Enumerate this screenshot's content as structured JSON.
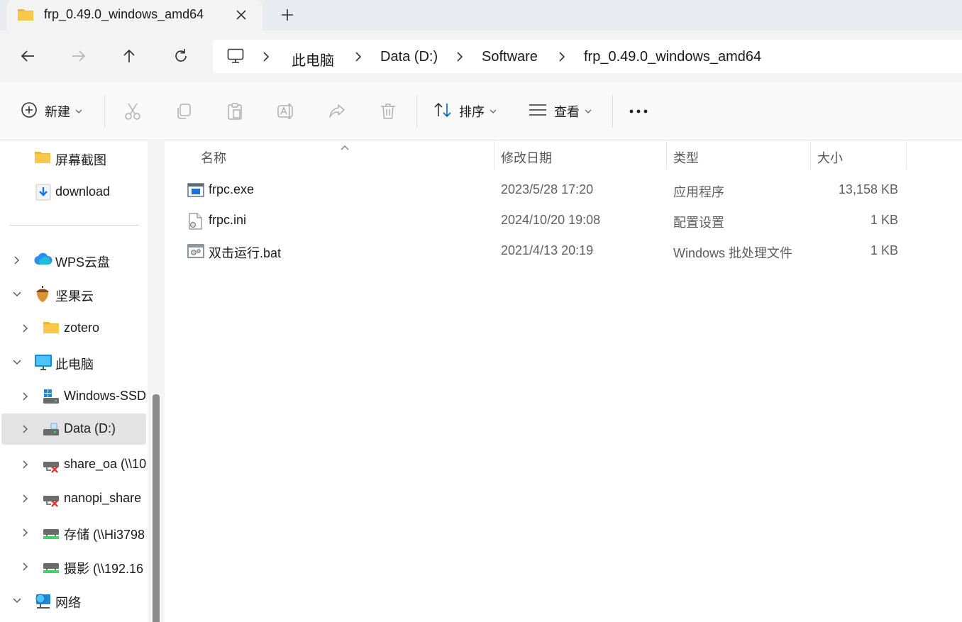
{
  "tab": {
    "title": "frp_0.49.0_windows_amd64",
    "close_icon": "close-icon",
    "new_tab_icon": "plus-icon"
  },
  "nav": {
    "back_icon": "arrow-left-icon",
    "forward_icon": "arrow-right-icon",
    "up_icon": "arrow-up-icon",
    "refresh_icon": "refresh-icon"
  },
  "address": {
    "root_icon": "computer-icon",
    "crumbs": [
      "此电脑",
      "Data (D:)",
      "Software",
      "frp_0.49.0_windows_amd64"
    ]
  },
  "toolbar": {
    "new_label": "新建",
    "sort_label": "排序",
    "view_label": "查看",
    "more_icon": "more-icon",
    "icons": [
      "cut-icon",
      "copy-icon",
      "paste-icon",
      "rename-icon",
      "share-icon",
      "delete-icon"
    ]
  },
  "sidebar": {
    "items": [
      {
        "label": "屏幕截图",
        "icon": "folder-icon"
      },
      {
        "label": "download",
        "icon": "download-icon"
      },
      {
        "label": "WPS云盘",
        "icon": "cloud-icon"
      },
      {
        "label": "坚果云",
        "icon": "nutstore-icon"
      },
      {
        "label": "zotero",
        "icon": "folder-icon"
      },
      {
        "label": "此电脑",
        "icon": "computer-icon"
      },
      {
        "label": "Windows-SSD",
        "icon": "system-drive-icon"
      },
      {
        "label": "Data (D:)",
        "icon": "drive-icon"
      },
      {
        "label": "share_oa (\\\\10",
        "icon": "network-drive-disconnected-icon"
      },
      {
        "label": "nanopi_share",
        "icon": "network-drive-disconnected-icon"
      },
      {
        "label": "存储 (\\\\Hi3798",
        "icon": "network-drive-icon"
      },
      {
        "label": "摄影 (\\\\192.16",
        "icon": "network-drive-icon"
      },
      {
        "label": "网络",
        "icon": "network-icon"
      }
    ]
  },
  "columns": {
    "name": "名称",
    "modified": "修改日期",
    "type": "类型",
    "size": "大小"
  },
  "files": [
    {
      "name": "frpc.exe",
      "modified": "2023/5/28 17:20",
      "type": "应用程序",
      "size": "13,158 KB",
      "icon": "exe-icon"
    },
    {
      "name": "frpc.ini",
      "modified": "2024/10/20 19:08",
      "type": "配置设置",
      "size": "1 KB",
      "icon": "config-file-icon"
    },
    {
      "name": "双击运行.bat",
      "modified": "2021/4/13 20:19",
      "type": "Windows 批处理文件",
      "size": "1 KB",
      "icon": "batch-file-icon"
    }
  ],
  "colors": {
    "accent": "#0067c0",
    "folder": "#f8c84a",
    "selected_bg": "#e3e3e3"
  }
}
